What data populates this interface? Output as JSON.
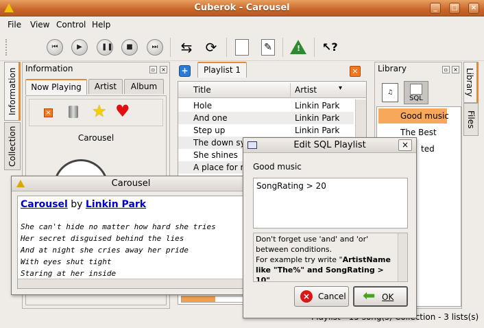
{
  "window": {
    "title": "Cuberok - Carousel"
  },
  "menu": [
    "File",
    "View",
    "Control",
    "Help"
  ],
  "left_tabs": [
    "Information",
    "Collection"
  ],
  "info_panel": {
    "title": "Information",
    "tabs": [
      "Now Playing",
      "Artist",
      "Album"
    ],
    "song": "Carousel"
  },
  "playlist": {
    "tab": "Playlist 1",
    "col_title": "Title",
    "col_artist": "Artist",
    "rows": [
      {
        "title": "Hole",
        "artist": "Linkin Park"
      },
      {
        "title": "And one",
        "artist": "Linkin Park"
      },
      {
        "title": "Step up",
        "artist": "Linkin Park"
      },
      {
        "title": "The down syn",
        "artist": ""
      },
      {
        "title": "She shines",
        "artist": ""
      },
      {
        "title": "A place for m",
        "artist": ""
      }
    ]
  },
  "library": {
    "title": "Library",
    "sql_label": "SQL",
    "items": [
      "Good music",
      "The Best",
      "ted"
    ]
  },
  "right_tabs": [
    "Library",
    "Files"
  ],
  "status": "Playlist - 15 song(s)   Collection - 3 lists(s)",
  "lyrics": {
    "title": "Carousel",
    "song_link": "Carousel",
    "by": "by",
    "artist_link": "Linkin Park",
    "lines": [
      "She can't hide no matter how hard she tries",
      "Her secret disguised behind the lies",
      "And at night she cries away her pride",
      "With eyes shut tight",
      "Staring at her inside"
    ]
  },
  "sql_dialog": {
    "title": "Edit SQL Playlist",
    "name": "Good music",
    "query": "SongRating > 20",
    "help1": "Don't forget use 'and' and 'or'",
    "help2": "between conditions.",
    "help3": "For example try write \"",
    "help_bold1": "ArtistName",
    "help_bold2": "like \"The%\" and SongRating >",
    "help_bold3": "10\"",
    "cancel": "Cancel",
    "ok": "OK"
  },
  "colors": {
    "accent": "#e28a3c",
    "selected": "#f7a85a",
    "link": "#0000cc"
  }
}
